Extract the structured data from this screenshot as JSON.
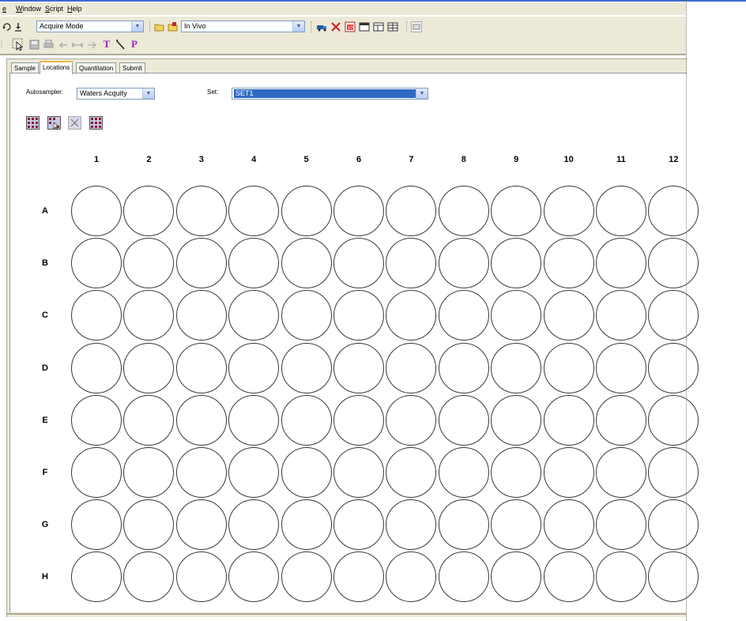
{
  "menu": {
    "items": [
      "e",
      "Window",
      "Script",
      "Help"
    ]
  },
  "toolbar1": {
    "mode_value": "Acquire Mode",
    "project_value": "In Vivo",
    "icons": [
      "refresh-icon",
      "download-icon",
      "open-folder-icon",
      "folder-star-icon",
      "truck-icon",
      "delete-x-icon",
      "report-icon",
      "window-icon",
      "layout-icon",
      "grid-icon",
      "print-preview-icon"
    ]
  },
  "toolbar2": {
    "icons": [
      "cursor-select-icon",
      "save-icon",
      "print-icon",
      "undo-icon",
      "measure-icon",
      "arrow-icon",
      "text-t-icon",
      "wand-icon",
      "peak-p-icon"
    ],
    "text_t": "T",
    "text_p": "P"
  },
  "tabs": [
    {
      "label": "Sample",
      "active": false
    },
    {
      "label": "Locations",
      "active": true
    },
    {
      "label": "Quantitation",
      "active": false
    },
    {
      "label": "Submit",
      "active": false
    }
  ],
  "form": {
    "autosampler_label": "Autosampler:",
    "autosampler_value": "Waters Acquity",
    "set_label": "Set:",
    "set_value": "SET1"
  },
  "plate_buttons": [
    "plate-select-all-icon",
    "plate-select-some-icon",
    "plate-clear-icon",
    "plate-full-icon"
  ],
  "plate": {
    "columns": [
      "1",
      "2",
      "3",
      "4",
      "5",
      "6",
      "7",
      "8",
      "9",
      "10",
      "11",
      "12"
    ],
    "rows": [
      "A",
      "B",
      "C",
      "D",
      "E",
      "F",
      "G",
      "H"
    ]
  },
  "colors": {
    "selection": "#316ac5",
    "tab_highlight": "#f7b64a",
    "toolbar_bg": "#ece9d8"
  }
}
